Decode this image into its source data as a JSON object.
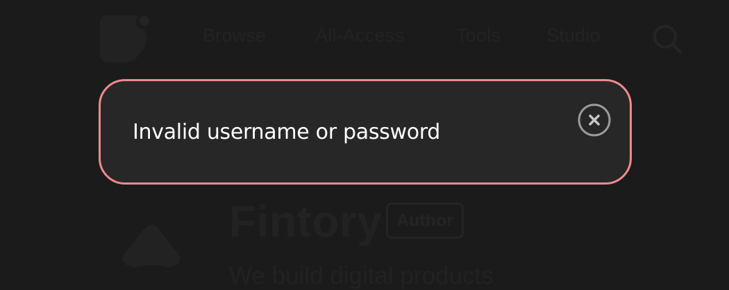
{
  "nav": {
    "items": [
      {
        "label": "Browse"
      },
      {
        "label": "All-Access"
      },
      {
        "label": "Tools"
      },
      {
        "label": "Studio"
      }
    ],
    "search_icon": "search-icon",
    "logo_icon": "brand-logo-icon"
  },
  "product": {
    "title": "Fintory",
    "badge": "Author",
    "tagline": "We build digital products"
  },
  "toast": {
    "message": "Invalid username or password",
    "close_icon": "close-circle-icon",
    "border_color": "#f08a8c",
    "background_color": "#272728",
    "text_color": "#ffffff"
  },
  "colors": {
    "page_background": "#1b1b1c",
    "dimmed_foreground": "#232324"
  }
}
